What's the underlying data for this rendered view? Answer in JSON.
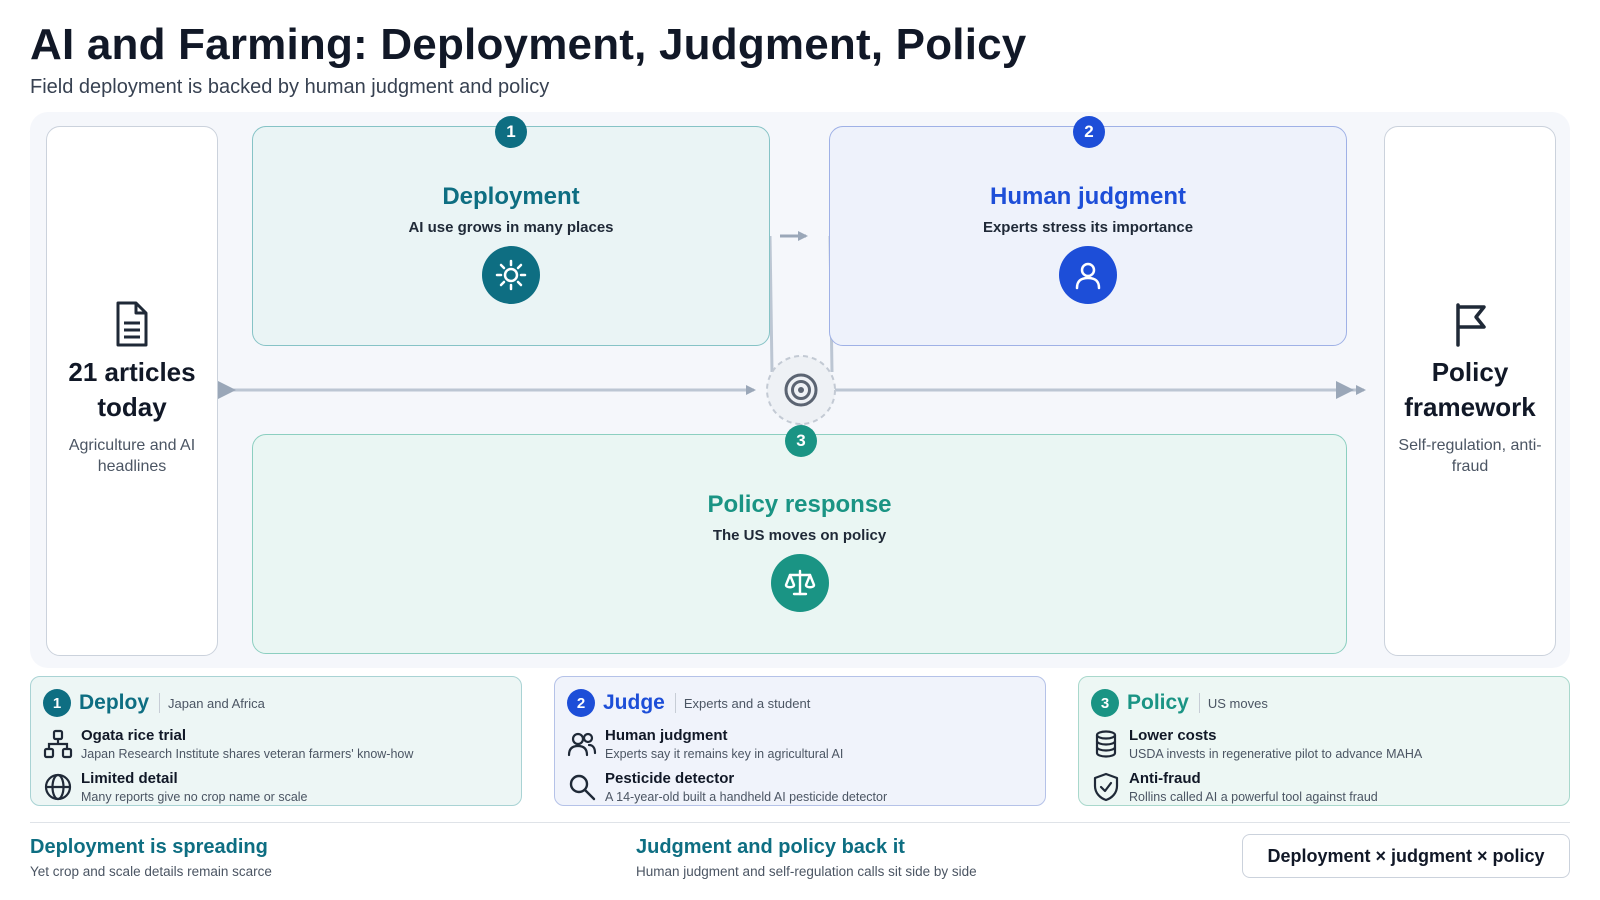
{
  "header": {
    "title": "AI and Farming: Deployment, Judgment, Policy",
    "subtitle": "Field deployment is backed by human judgment and policy"
  },
  "colors": {
    "teal_dark": "#0e6e82",
    "teal": "#1a9484",
    "blue": "#1d4ed8",
    "arrow": "#9aa7b8"
  },
  "flow": {
    "source": {
      "icon": "document-icon",
      "headline": "21 articles today",
      "caption": "Agriculture and AI headlines"
    },
    "target": {
      "icon": "flag-icon",
      "headline": "Policy framework",
      "caption": "Self-regulation, anti-fraud"
    },
    "hub_icon": "target-icon",
    "stages": [
      {
        "num": "1",
        "title": "Deployment",
        "subtitle": "AI use grows in many places",
        "icon": "sun-icon"
      },
      {
        "num": "2",
        "title": "Human judgment",
        "subtitle": "Experts stress its importance",
        "icon": "person-icon"
      },
      {
        "num": "3",
        "title": "Policy response",
        "subtitle": "The US moves on policy",
        "icon": "scale-icon"
      }
    ]
  },
  "panels": [
    {
      "num": "1",
      "title": "Deploy",
      "note": "Japan and Africa",
      "items": [
        {
          "icon": "hierarchy-icon",
          "title": "Ogata rice trial",
          "desc": "Japan Research Institute shares veteran farmers' know-how"
        },
        {
          "icon": "globe-icon",
          "title": "Limited detail",
          "desc": "Many reports give no crop name or scale"
        }
      ]
    },
    {
      "num": "2",
      "title": "Judge",
      "note": "Experts and a student",
      "items": [
        {
          "icon": "users-icon",
          "title": "Human judgment",
          "desc": "Experts say it remains key in agricultural AI"
        },
        {
          "icon": "search-icon",
          "title": "Pesticide detector",
          "desc": "A 14-year-old built a handheld AI pesticide detector"
        }
      ]
    },
    {
      "num": "3",
      "title": "Policy",
      "note": "US moves",
      "items": [
        {
          "icon": "database-icon",
          "title": "Lower costs",
          "desc": "USDA invests in regenerative pilot to advance MAHA"
        },
        {
          "icon": "shield-check-icon",
          "title": "Anti-fraud",
          "desc": "Rollins called AI a powerful tool against fraud"
        }
      ]
    }
  ],
  "footer": {
    "left_title": "Deployment is spreading",
    "left_sub": "Yet crop and scale details remain scarce",
    "mid_title": "Judgment and policy back it",
    "mid_sub": "Human judgment and self-regulation calls sit side by side",
    "pill": "Deployment × judgment × policy"
  }
}
